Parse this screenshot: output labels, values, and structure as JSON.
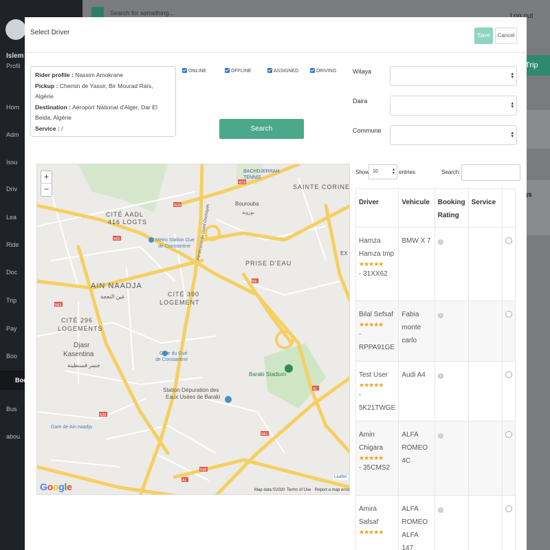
{
  "background": {
    "user_name": "Islem",
    "user_sub": "Profil",
    "nav": [
      "Hom",
      "Adm",
      "Issu",
      "Driv",
      "Lea",
      "Ride",
      "Doc",
      "Trip",
      "Pay",
      "Boo",
      "Boo",
      "Bus",
      "abou"
    ],
    "search_text": "Search for something...",
    "logout": "Log out",
    "add_trip": "Trip",
    "card_label": "gs"
  },
  "modal": {
    "title": "Select Driver",
    "save": "Save",
    "cancel": "Cancel",
    "rider": {
      "profile_label": "Rider profile :",
      "profile_value": "Nassim Amokrane",
      "pickup_label": "Pickup :",
      "pickup_value": "Chemin de Yassir, Bir Mourad Raïs, Algérie",
      "destination_label": "Destination :",
      "destination_value": "Aéroport National d'Alger, Dar El Beida, Algérie",
      "service_label": "Service :",
      "service_value": "/"
    },
    "filters": [
      "ONLINE",
      "OFFLINE",
      "ASSIGNED",
      "DRIVING"
    ],
    "search_button": "Search",
    "wilaya_label": "Wilaya",
    "daira_label": "Daira",
    "commune_label": "Commune"
  },
  "map": {
    "labels": {
      "sainte_corine": "SAINTE CORINE",
      "bachdjerrah": "BACHDJERRAH",
      "tennis": "TENNIS",
      "bourouba": "Bourouba",
      "bourouba_ar": "بوروبة",
      "cite_aadl": "CITÉ AADL",
      "logts": "416 LOGTS",
      "metro": "Metro Station Gue",
      "metro2": "de Constantine",
      "prise": "PRISE D'EAU",
      "ain_naadja": "AIN NAADJA",
      "ain_naadja_ar": "عين النعجة",
      "cite_390": "CITÉ 390",
      "logement": "LOGEMENT",
      "cite_296": "CITÉ 296",
      "logements": "LOGEMENTS",
      "djasr": "Djasr",
      "kasentina": "Kasentina",
      "kasentina_ar": "جسر قسنطينة",
      "gare_gue": "Gare du Gué",
      "gare_gue2": "de Constantine",
      "baraki_stadium": "Baraki Stadium",
      "station_dep": "Station Dépuration des",
      "station_dep2": "Eaux Usées de Baraki",
      "gare_ain": "Gare de Ain naadja",
      "penetrante": "Pénétrante de Oued Ouchayeh",
      "ex": "EX"
    },
    "roads": [
      "N5",
      "N38",
      "N63",
      "N1",
      "W15",
      "A1",
      "N61"
    ],
    "zoom_in": "+",
    "zoom_out": "−",
    "attribution": [
      "Map data ©2020",
      "Terms of Use",
      "Report a map error"
    ],
    "leaflet": "Leaflet",
    "google": [
      "G",
      "o",
      "o",
      "g",
      "l",
      "e"
    ]
  },
  "table": {
    "show": "Show",
    "page_size": "10",
    "entries": "entries",
    "search_label": "Search:",
    "columns": [
      "Driver",
      "Vehicule",
      "Booking Rating",
      "Service",
      ""
    ],
    "rows": [
      {
        "driver": "Hamza Hamza tmp",
        "plate": "- 31XX62",
        "vehicle": "BMW X 7"
      },
      {
        "driver": "Bilal Sefsaf",
        "plate": "- RPPA91GE",
        "vehicle": "Fabia monte carlo"
      },
      {
        "driver": "Test User",
        "plate": "- 5K21TWGE",
        "vehicle": "Audi A4"
      },
      {
        "driver": "Amin Chigara",
        "plate": "- 35CMS2",
        "vehicle": "ALFA ROMEO 4C"
      },
      {
        "driver": "Amira Safsaf",
        "plate": "",
        "vehicle": "ALFA ROMEO ALFA 147"
      }
    ],
    "stars": "★★★★★",
    "info_icon": "i",
    "star_color": "#f0a020"
  }
}
